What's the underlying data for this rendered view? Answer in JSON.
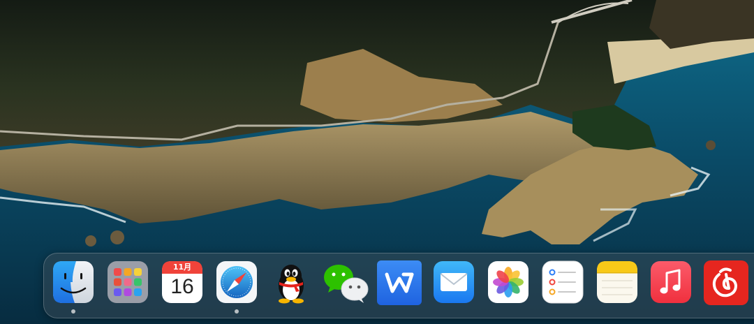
{
  "desktop": {
    "wallpaper": "coastal-cliffs-bridge-wallpaper"
  },
  "dock": {
    "apps": [
      {
        "id": "finder",
        "icon": "finder-icon",
        "running": true
      },
      {
        "id": "launchpad",
        "icon": "launchpad-icon",
        "running": false
      },
      {
        "id": "calendar",
        "icon": "calendar-icon",
        "month": "11月",
        "day": "16",
        "running": false
      },
      {
        "id": "safari",
        "icon": "safari-icon",
        "running": true
      },
      {
        "id": "qq",
        "icon": "qq-penguin-icon",
        "running": false
      },
      {
        "id": "wechat",
        "icon": "wechat-icon",
        "running": false
      },
      {
        "id": "wps",
        "icon": "wps-office-icon",
        "running": false
      },
      {
        "id": "mail",
        "icon": "mail-icon",
        "running": false
      },
      {
        "id": "photos",
        "icon": "photos-icon",
        "running": false
      },
      {
        "id": "reminders",
        "icon": "reminders-icon",
        "running": false
      },
      {
        "id": "notes",
        "icon": "notes-icon",
        "running": false
      },
      {
        "id": "music",
        "icon": "music-icon",
        "running": false
      },
      {
        "id": "netease-music",
        "icon": "netease-cloud-music-icon",
        "running": false
      }
    ]
  },
  "colors": {
    "sea": "#0e5a7a",
    "cliff": "#8a7a55",
    "forest": "#1f2b1e",
    "dock_glass": "#46505a",
    "running_dot": "#ebebeb"
  }
}
